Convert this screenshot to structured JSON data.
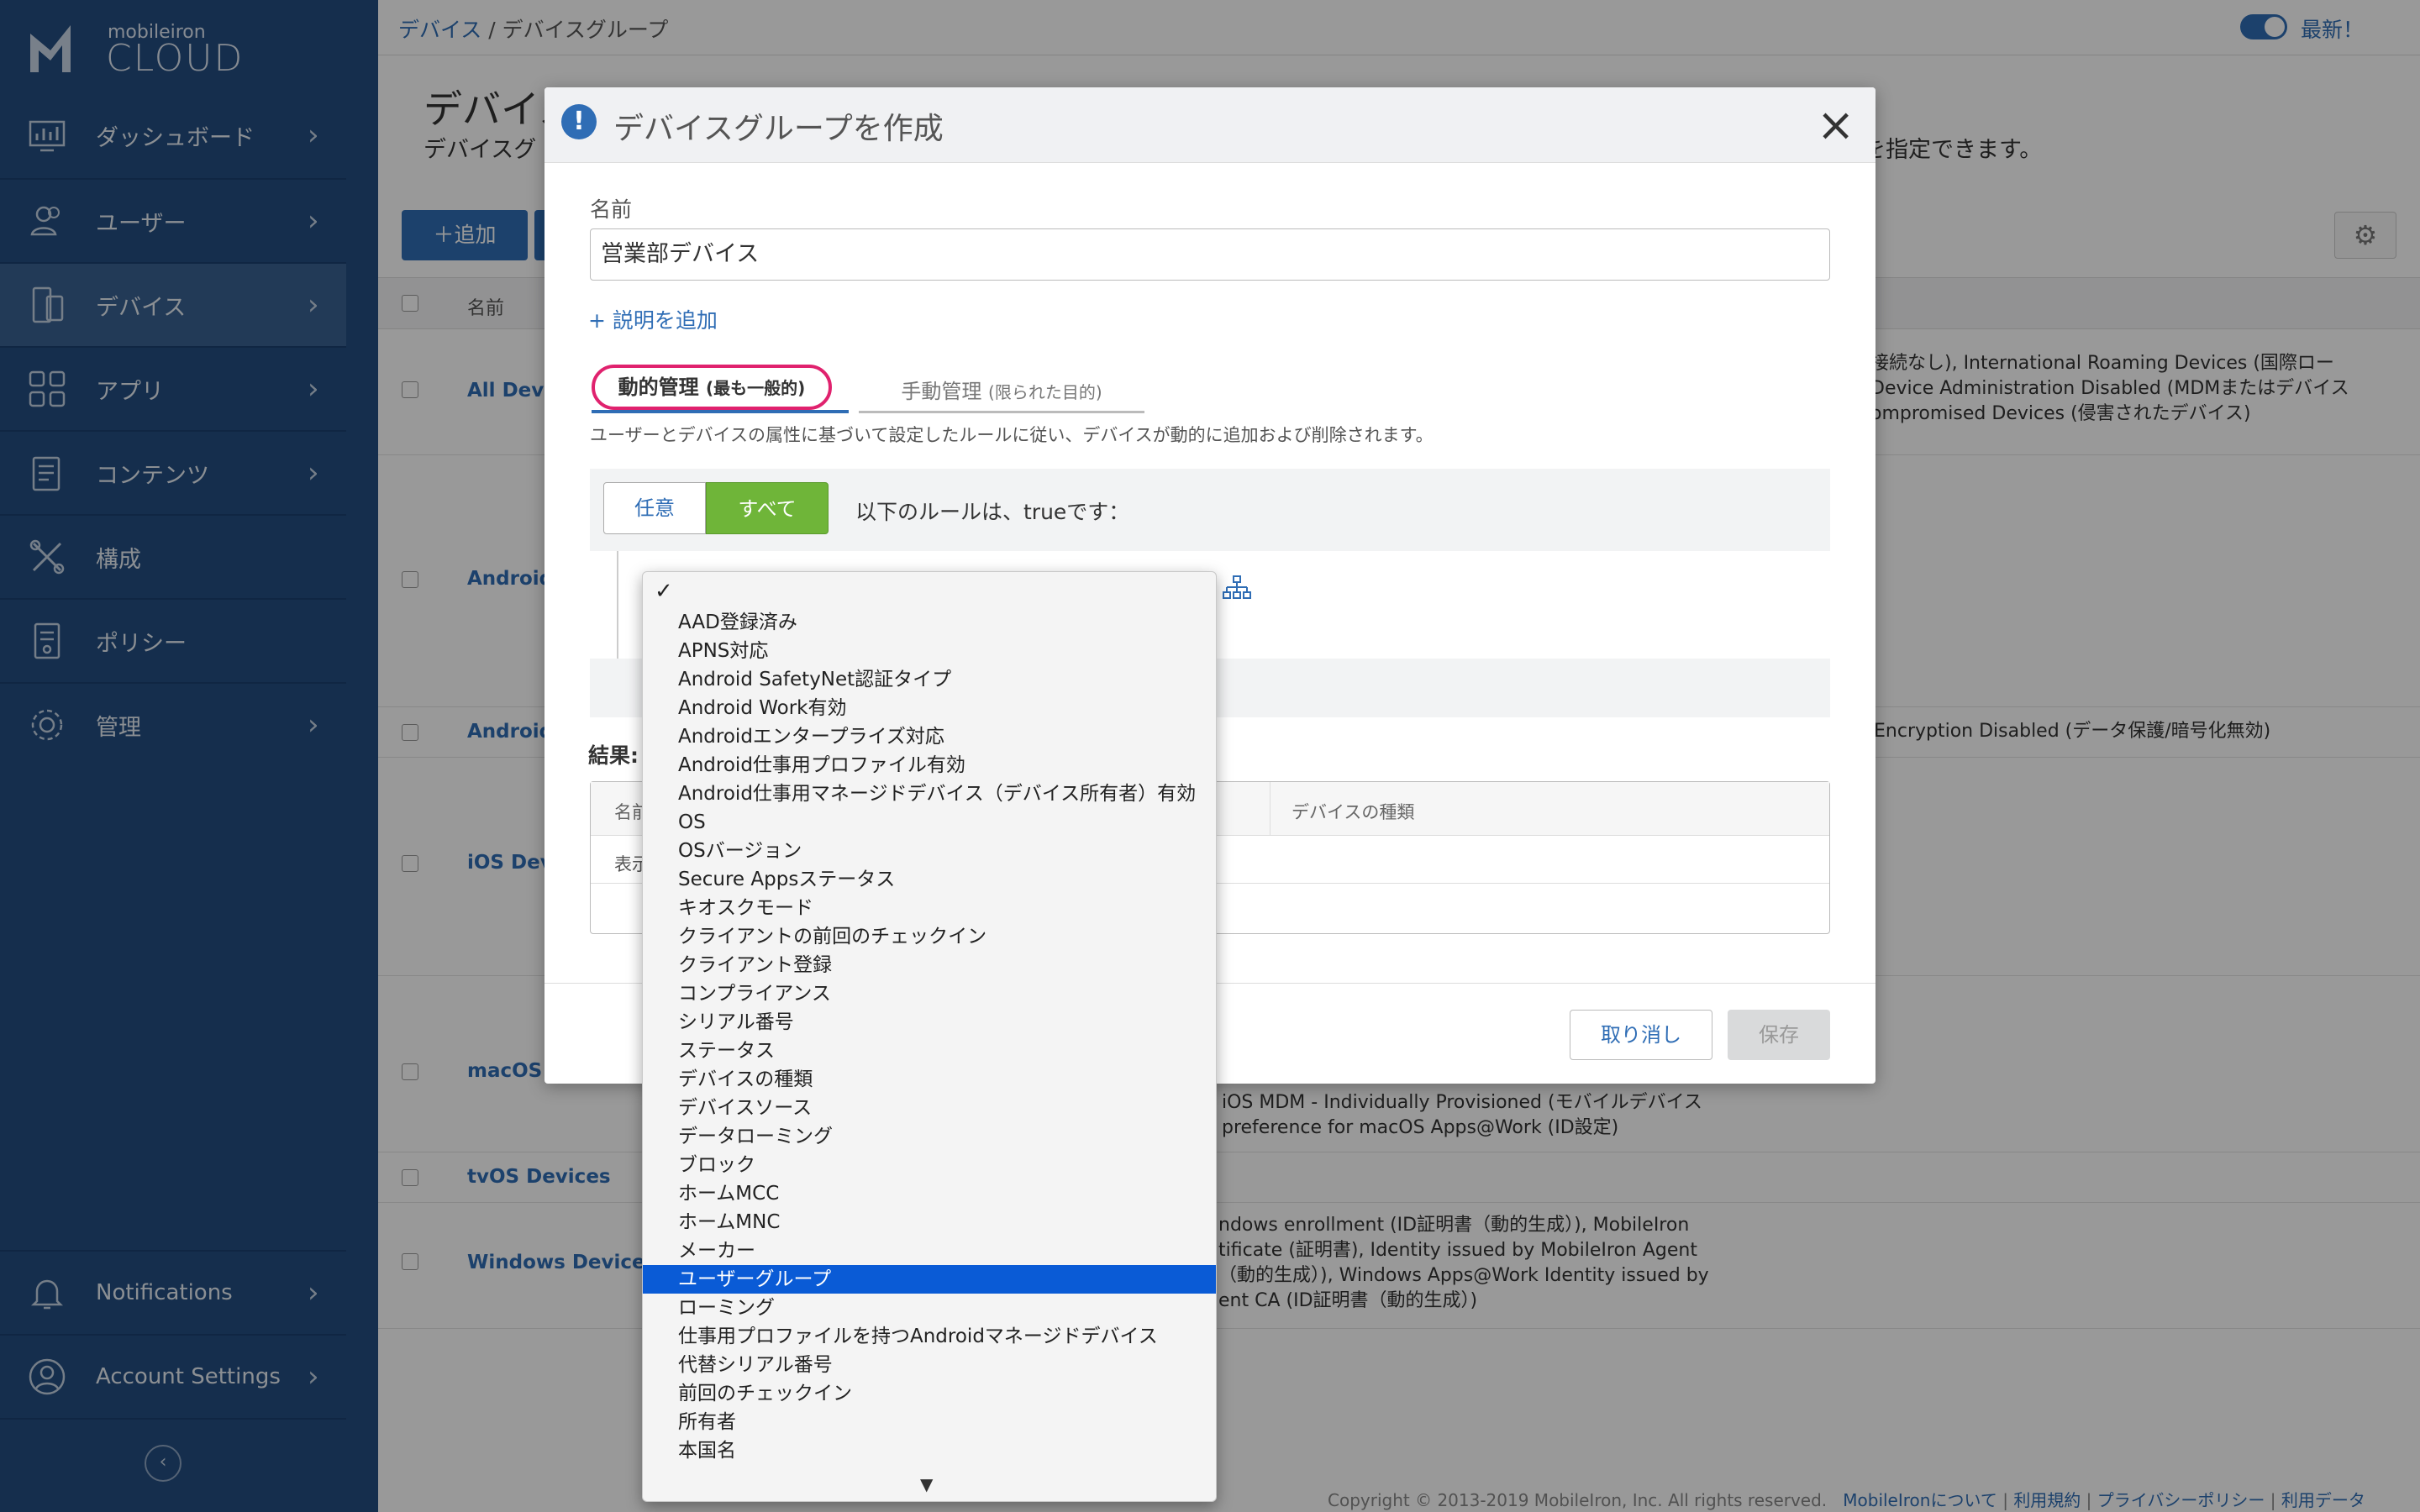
{
  "sidebar": {
    "logo_small": "mobileiron",
    "logo_big": "CLOUD",
    "items": [
      {
        "label": "ダッシュボード",
        "icon": "dashboard-icon"
      },
      {
        "label": "ユーザー",
        "icon": "users-icon"
      },
      {
        "label": "デバイス",
        "icon": "devices-icon"
      },
      {
        "label": "アプリ",
        "icon": "apps-icon"
      },
      {
        "label": "コンテンツ",
        "icon": "content-icon"
      },
      {
        "label": "構成",
        "icon": "configuration-icon"
      },
      {
        "label": "ポリシー",
        "icon": "policy-icon"
      },
      {
        "label": "管理",
        "icon": "admin-gear-icon"
      }
    ],
    "bottom": [
      {
        "label": "Notifications",
        "icon": "bell-icon"
      },
      {
        "label": "Account Settings",
        "icon": "account-icon"
      }
    ]
  },
  "topbar": {
    "breadcrumb_link": "デバイス",
    "breadcrumb_sep": " / ",
    "breadcrumb_current": "デバイスグループ",
    "latest": "最新！"
  },
  "page": {
    "title": "デバイス",
    "desc_left": "デバイスグ",
    "desc_right": "成を指定できます。",
    "add_button": "＋追加",
    "col_name": "名前",
    "rows": [
      {
        "name": "All Devic",
        "desc": [
          "接続なし), International Roaming Devices (国際ロー",
          "Device Administration Disabled (MDMまたはデバイス",
          "ompromised Devices (侵害されたデバイス)"
        ]
      },
      {
        "name": "Android",
        "desc": []
      },
      {
        "name": "Android",
        "desc": [
          "Encryption Disabled (データ保護/暗号化無効)"
        ]
      },
      {
        "name": "iOS Devi",
        "desc": []
      },
      {
        "name": "macOS D",
        "desc": [
          "iOS MDM - Individually Provisioned (モバイルデバイス",
          "preference for macOS Apps@Work (ID設定)"
        ]
      },
      {
        "name": "tvOS Devices",
        "desc": []
      },
      {
        "name": "Windows Devices",
        "desc": [
          "ndows enrollment (ID証明書（動的生成）), MobileIron",
          "tificate (証明書), Identity issued by MobileIron Agent",
          "（動的生成）), Windows Apps@Work Identity issued by",
          "ent CA (ID証明書（動的生成）)"
        ]
      }
    ],
    "footer_copy": "Copyright © 2013-2019 MobileIron, Inc. All rights reserved.",
    "footer_links": [
      "MobileIronについて",
      "利用規約",
      "プライバシーポリシー",
      "利用データ"
    ]
  },
  "modal": {
    "title": "デバイスグループを作成",
    "name_label": "名前",
    "name_value": "営業部デバイス",
    "add_description": "+ 説明を追加",
    "tab_dynamic": "動的管理",
    "tab_dynamic_note": "(最も一般的)",
    "tab_manual": "手動管理",
    "tab_manual_note": "(限られた目的)",
    "rule_description": "ユーザーとデバイスの属性に基づいて設定したルールに従い、デバイスが動的に追加および削除されます。",
    "btn_any": "任意",
    "btn_all": "すべて",
    "rule_text": "以下のルールは、trueです：",
    "result_label": "結果:",
    "result_col_name": "名前",
    "result_col_type": "デバイスの種類",
    "result_row": "表示",
    "cancel": "取り消し",
    "save": "保存"
  },
  "dropdown": {
    "check": "✓",
    "selected": "ユーザーグループ",
    "items": [
      "AAD登録済み",
      "APNS対応",
      "Android SafetyNet認証タイプ",
      "Android Work有効",
      "Androidエンタープライズ対応",
      "Android仕事用プロファイル有効",
      "Android仕事用マネージドデバイス（デバイス所有者）有効",
      "OS",
      "OSバージョン",
      "Secure Appsステータス",
      "キオスクモード",
      "クライアントの前回のチェックイン",
      "クライアント登録",
      "コンプライアンス",
      "シリアル番号",
      "ステータス",
      "デバイスの種類",
      "デバイスソース",
      "データローミング",
      "ブロック",
      "ホームMCC",
      "ホームMNC",
      "メーカー",
      "ユーザーグループ",
      "ローミング",
      "仕事用プロファイルを持つAndroidマネージドデバイス",
      "代替シリアル番号",
      "前回のチェックイン",
      "所有者",
      "本国名"
    ],
    "more_arrow": "▼"
  },
  "colors": {
    "sidebar": "#234d80",
    "accent": "#2f6db5",
    "green": "#6fb539",
    "highlight": "#0a5bd6",
    "tab_circle": "#e0226e"
  }
}
